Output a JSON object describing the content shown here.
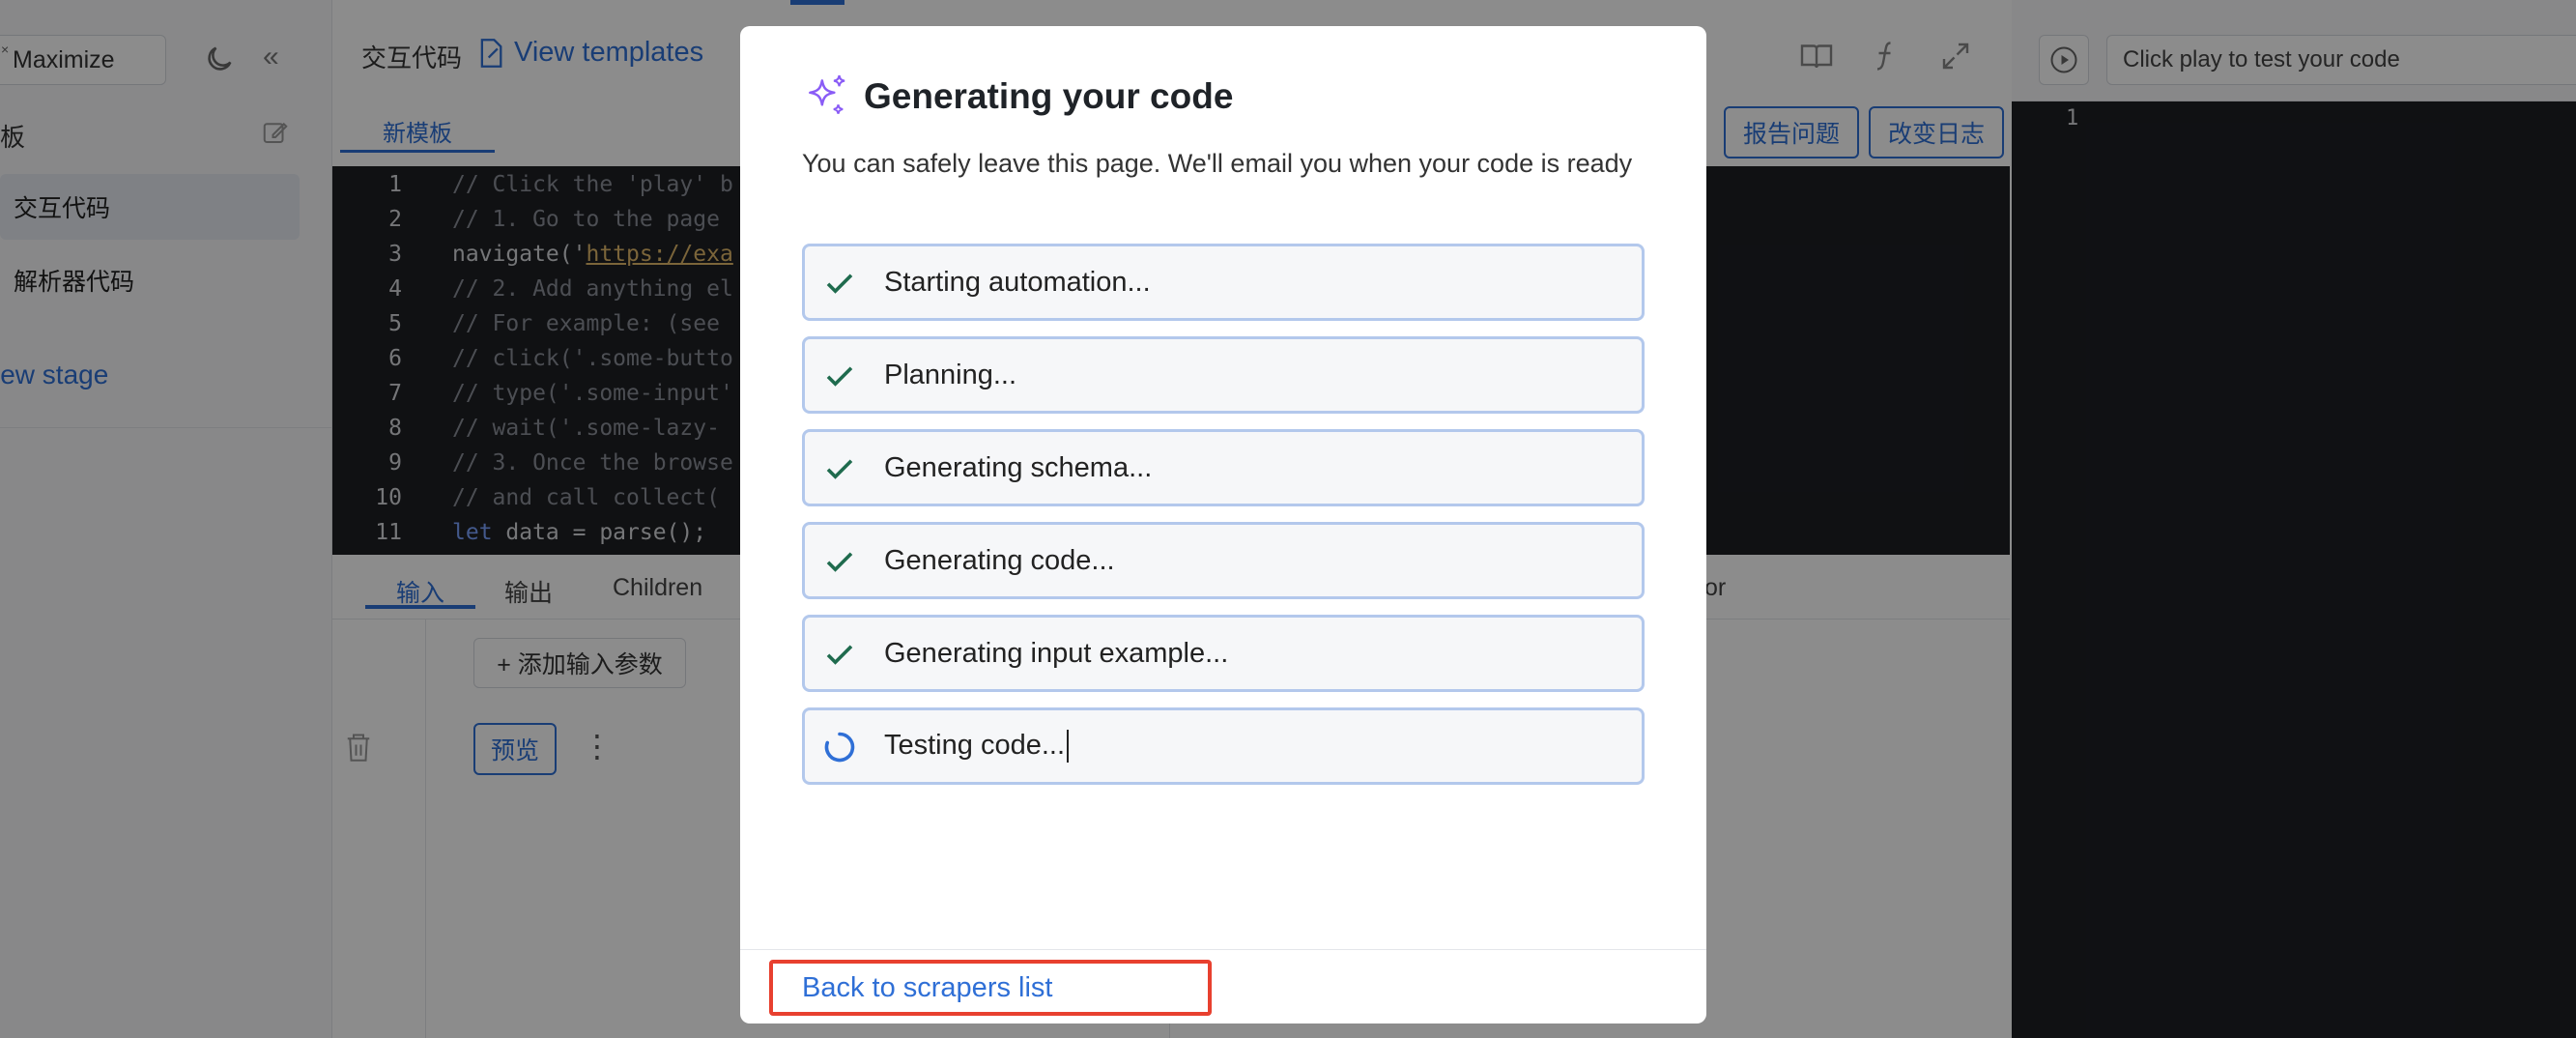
{
  "sidebar": {
    "maximize_label": "Maximize",
    "close_glyph": "×",
    "collapse_glyph": "«",
    "section_label": "板",
    "items": [
      {
        "label": "交互代码",
        "active": true
      },
      {
        "label": "解析器代码",
        "active": false
      }
    ],
    "new_stage_label": "lew stage"
  },
  "header": {
    "title": "交互代码",
    "view_templates_label": "View templates",
    "icons": [
      "book-icon",
      "function-icon",
      "expand-icon"
    ]
  },
  "editor": {
    "subtab_label": "新模板",
    "report_button": "报告问题",
    "changelog_button": "改变日志",
    "lines": [
      {
        "n": "1",
        "text": "// Click the 'play' b"
      },
      {
        "n": "2",
        "text": "// 1. Go to the page"
      },
      {
        "n": "3",
        "pre": "navigate('",
        "url": "https://exa",
        "post": ""
      },
      {
        "n": "4",
        "text": "// 2. Add anything el"
      },
      {
        "n": "5",
        "text": "// For example: (see"
      },
      {
        "n": "6",
        "text": "// click('.some-butto"
      },
      {
        "n": "7",
        "text": "// type('.some-input'"
      },
      {
        "n": "8",
        "text": "// wait('.some-lazy-"
      },
      {
        "n": "9",
        "text": "// 3. Once the browse"
      },
      {
        "n": "10",
        "text": "// and call collect("
      },
      {
        "n": "11",
        "kw": "let",
        "rest": " data = parse();"
      }
    ]
  },
  "bottom_tabs": {
    "tabs": [
      "输入",
      "输出",
      "Children"
    ],
    "partial_tab": "or",
    "add_param_label": "+ 添加输入参数",
    "preview_label": "预览",
    "more_glyph": "⋮"
  },
  "right_panel": {
    "placeholder": "Click play to test your code",
    "line_number": "1"
  },
  "modal": {
    "title": "Generating your code",
    "subtitle": "You can safely leave this page. We'll email you when your code is ready",
    "steps": [
      {
        "label": "Starting automation...",
        "status": "done"
      },
      {
        "label": "Planning...",
        "status": "done"
      },
      {
        "label": "Generating schema...",
        "status": "done"
      },
      {
        "label": "Generating code...",
        "status": "done"
      },
      {
        "label": "Generating input example...",
        "status": "done"
      },
      {
        "label": "Testing code...",
        "status": "in-progress"
      }
    ],
    "back_link": "Back to scrapers list"
  },
  "colors": {
    "accent": "#2f6fd6",
    "check": "#1f6b4e",
    "spinner": "#2f6fd6",
    "sparkle": "#8a5cf6",
    "highlight": "#e8402f"
  }
}
